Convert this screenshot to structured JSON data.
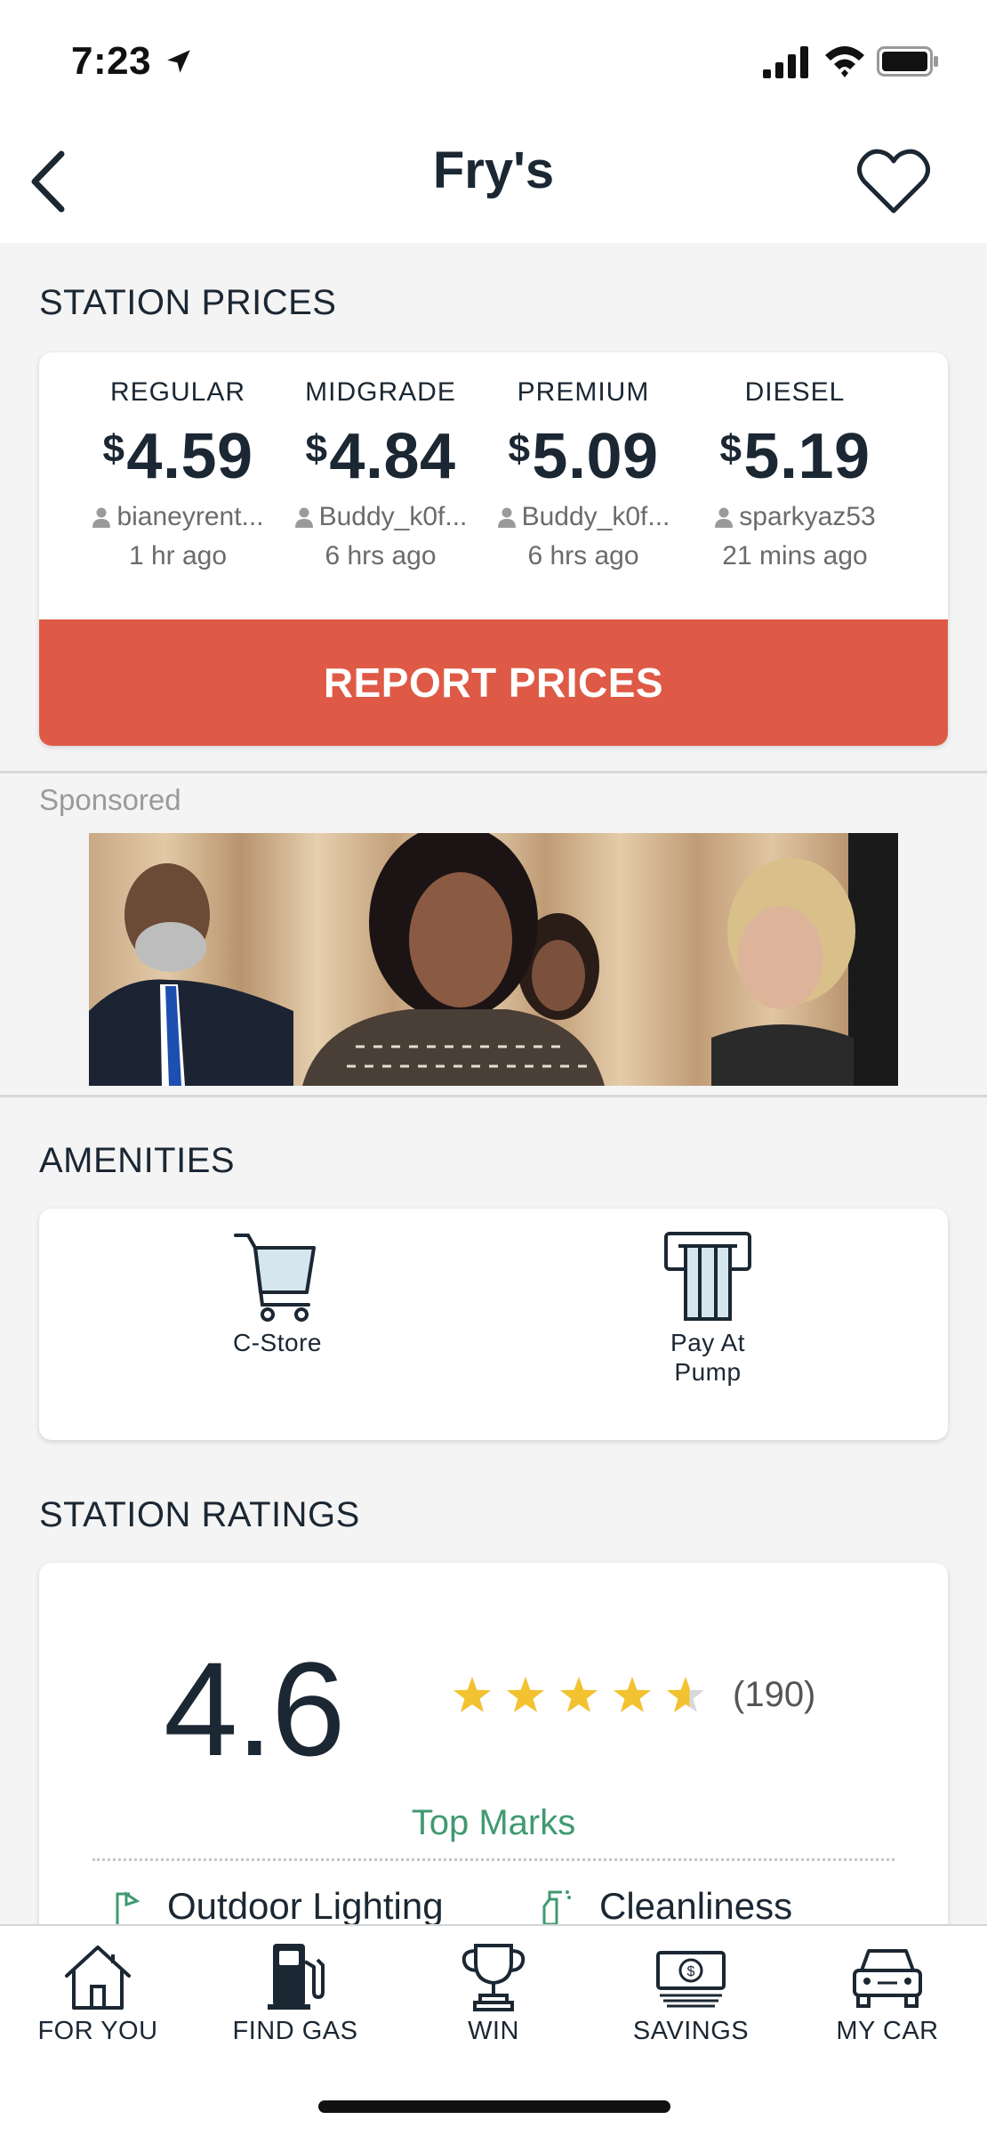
{
  "status_bar": {
    "time": "7:23"
  },
  "header": {
    "title": "Fry's"
  },
  "station_prices": {
    "section_title": "STATION PRICES",
    "currency_symbol": "$",
    "fuels": [
      {
        "name": "REGULAR",
        "price": "4.59",
        "user": "bianeyrent...",
        "time": "1 hr ago"
      },
      {
        "name": "MIDGRADE",
        "price": "4.84",
        "user": "Buddy_k0f...",
        "time": "6 hrs ago"
      },
      {
        "name": "PREMIUM",
        "price": "5.09",
        "user": "Buddy_k0f...",
        "time": "6 hrs ago"
      },
      {
        "name": "DIESEL",
        "price": "5.19",
        "user": "sparkyaz53",
        "time": "21 mins ago"
      }
    ],
    "report_button": "REPORT PRICES"
  },
  "ad": {
    "sponsored_label": "Sponsored"
  },
  "amenities": {
    "section_title": "AMENITIES",
    "items": [
      {
        "label": "C-Store",
        "icon": "shopping-cart-icon"
      },
      {
        "label": "Pay At\nPump",
        "icon": "card-reader-icon"
      }
    ]
  },
  "ratings": {
    "section_title": "STATION RATINGS",
    "score": "4.6",
    "stars_value": 4.6,
    "stars_max": 5,
    "count": "(190)",
    "top_marks_label": "Top Marks",
    "marks": [
      {
        "label": "Outdoor Lighting",
        "icon": "lamp-icon"
      },
      {
        "label": "Cleanliness",
        "icon": "spray-bottle-icon"
      }
    ]
  },
  "tabs": [
    {
      "label": "FOR YOU",
      "icon": "home-icon"
    },
    {
      "label": "FIND GAS",
      "icon": "gas-pump-icon"
    },
    {
      "label": "WIN",
      "icon": "trophy-icon"
    },
    {
      "label": "SAVINGS",
      "icon": "money-bill-icon"
    },
    {
      "label": "MY CAR",
      "icon": "car-icon"
    }
  ],
  "colors": {
    "accent_red": "#de5a46",
    "text_dark": "#1b2733",
    "star_yellow": "#f2c230",
    "green": "#3f9a6f"
  }
}
